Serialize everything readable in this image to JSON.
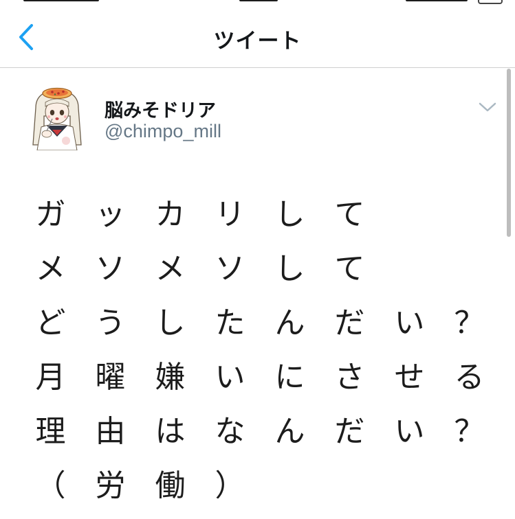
{
  "navbar": {
    "title": "ツイート",
    "back_icon": "chevron-left-icon",
    "accent_color": "#1da1f2"
  },
  "tweet": {
    "display_name": "脳みそドリア",
    "handle": "@chimpo_mill",
    "menu_icon": "chevron-down-icon",
    "lines": [
      [
        "ガ",
        "ッ",
        "カ",
        "リ",
        "し",
        "て"
      ],
      [
        "メ",
        "ソ",
        "メ",
        "ソ",
        "し",
        "て"
      ],
      [
        "ど",
        "う",
        "し",
        "た",
        "ん",
        "だ",
        "い",
        "？"
      ],
      [
        "月",
        "曜",
        "嫌",
        "い",
        "に",
        "さ",
        "せ",
        "る"
      ],
      [
        "理",
        "由",
        "は",
        "な",
        "ん",
        "だ",
        "い",
        "？"
      ],
      [
        "（",
        "労",
        "働",
        "）"
      ]
    ]
  },
  "colors": {
    "text": "#14171a",
    "secondary": "#657786",
    "divider": "#cfcfcf"
  }
}
